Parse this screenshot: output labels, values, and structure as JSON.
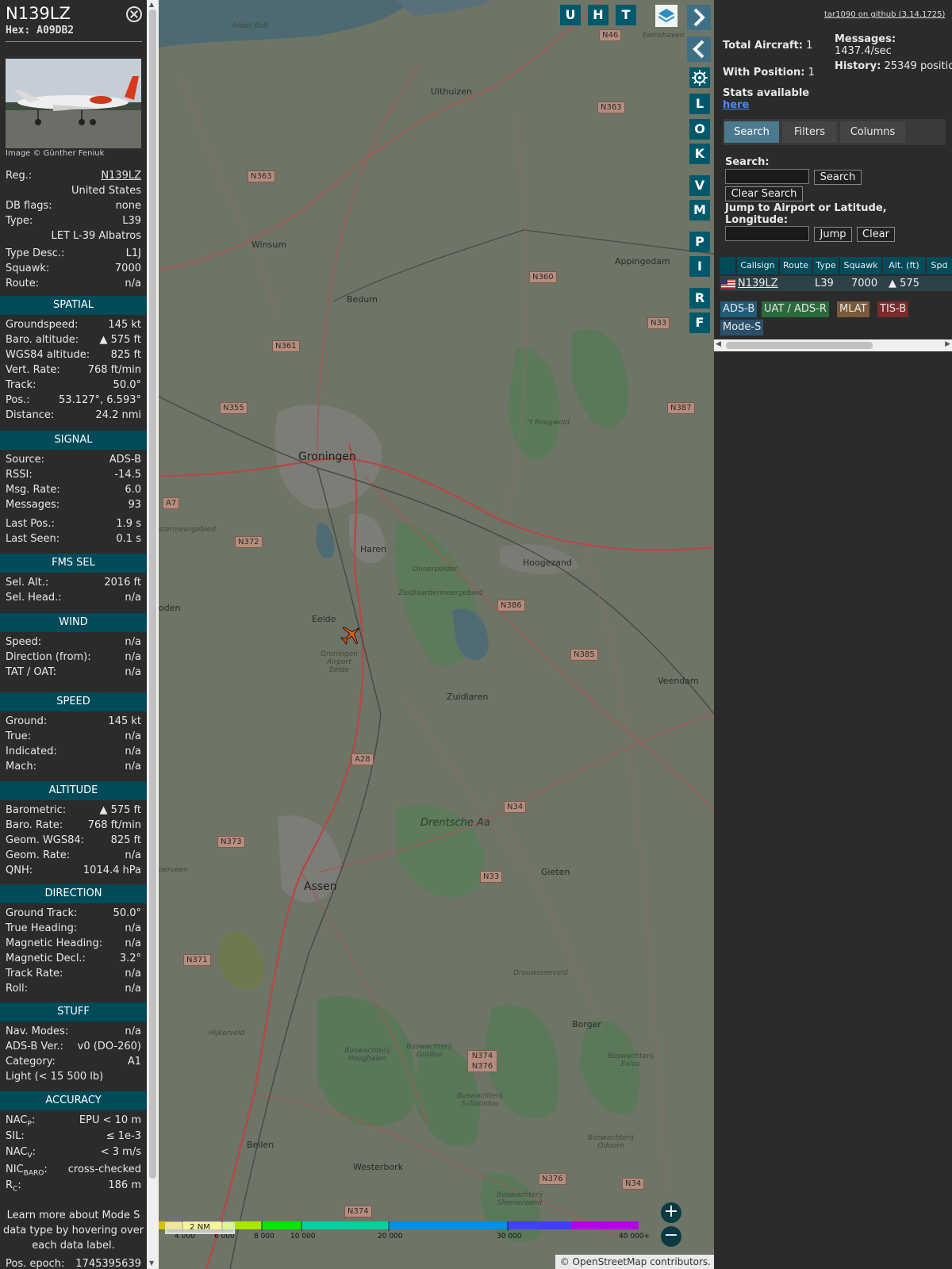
{
  "header": {
    "registration": "N139LZ",
    "hex_label": "Hex:",
    "hex": "A09DB2"
  },
  "photo": {
    "credit": "Image © Günther Feniuk"
  },
  "aircraft": [
    {
      "key": "Reg.:",
      "value": "N139LZ"
    },
    {
      "key": "",
      "value": "United States"
    },
    {
      "key": "DB flags:",
      "value": "none"
    },
    {
      "key": "Type:",
      "value": "L39"
    },
    {
      "key": "",
      "value": "LET L-39 Albatros"
    },
    {
      "key": "Type Desc.:",
      "value": "L1J"
    },
    {
      "key": "Squawk:",
      "value": "7000"
    },
    {
      "key": "Route:",
      "value": "n/a"
    }
  ],
  "sections": {
    "spatial": {
      "title": "SPATIAL",
      "rows": [
        {
          "key": "Groundspeed:",
          "value": "145 kt"
        },
        {
          "key": "Baro. altitude:",
          "value": "▲ 575 ft"
        },
        {
          "key": "WGS84 altitude:",
          "value": "825 ft"
        },
        {
          "key": "Vert. Rate:",
          "value": "768 ft/min"
        },
        {
          "key": "Track:",
          "value": "50.0°"
        },
        {
          "key": "Pos.:",
          "value": "53.127°, 6.593°"
        },
        {
          "key": "Distance:",
          "value": "24.2 nmi"
        }
      ]
    },
    "signal": {
      "title": "SIGNAL",
      "rows": [
        {
          "key": "Source:",
          "value": "ADS-B"
        },
        {
          "key": "RSSI:",
          "value": "-14.5"
        },
        {
          "key": "Msg. Rate:",
          "value": "6.0"
        },
        {
          "key": "Messages:",
          "value": "93"
        },
        {
          "key": "Last Pos.:",
          "value": "1.9 s"
        },
        {
          "key": "Last Seen:",
          "value": "0.1 s"
        }
      ]
    },
    "fms": {
      "title": "FMS SEL",
      "rows": [
        {
          "key": "Sel. Alt.:",
          "value": "2016 ft"
        },
        {
          "key": "Sel. Head.:",
          "value": "n/a"
        }
      ]
    },
    "wind": {
      "title": "WIND",
      "rows": [
        {
          "key": "Speed:",
          "value": "n/a"
        },
        {
          "key": "Direction (from):",
          "value": "n/a"
        },
        {
          "key": "TAT / OAT:",
          "value": "n/a"
        }
      ]
    },
    "speed": {
      "title": "SPEED",
      "rows": [
        {
          "key": "Ground:",
          "value": "145 kt"
        },
        {
          "key": "True:",
          "value": "n/a"
        },
        {
          "key": "Indicated:",
          "value": "n/a"
        },
        {
          "key": "Mach:",
          "value": "n/a"
        }
      ]
    },
    "altitude": {
      "title": "ALTITUDE",
      "rows": [
        {
          "key": "Barometric:",
          "value": "▲ 575 ft"
        },
        {
          "key": "Baro. Rate:",
          "value": "768 ft/min"
        },
        {
          "key": "Geom. WGS84:",
          "value": "825 ft"
        },
        {
          "key": "Geom. Rate:",
          "value": "n/a"
        },
        {
          "key": "QNH:",
          "value": "1014.4 hPa"
        }
      ]
    },
    "direction": {
      "title": "DIRECTION",
      "rows": [
        {
          "key": "Ground Track:",
          "value": "50.0°"
        },
        {
          "key": "True Heading:",
          "value": "n/a"
        },
        {
          "key": "Magnetic Heading:",
          "value": "n/a"
        },
        {
          "key": "Magnetic Decl.:",
          "value": "3.2°"
        },
        {
          "key": "Track Rate:",
          "value": "n/a"
        },
        {
          "key": "Roll:",
          "value": "n/a"
        }
      ]
    },
    "stuff": {
      "title": "STUFF",
      "rows": [
        {
          "key": "Nav. Modes:",
          "value": "n/a"
        },
        {
          "key": "ADS-B Ver.:",
          "value": "v0 (DO-260)"
        },
        {
          "key": "Category:",
          "value": "A1"
        },
        {
          "key": "Light (< 15 500 lb)",
          "value": ""
        }
      ]
    },
    "accuracy": {
      "title": "ACCURACY",
      "rows": [
        {
          "key": "NAC",
          "sub": "P",
          "value": "EPU < 10 m"
        },
        {
          "key": "SIL:",
          "sub": "",
          "value": "≤ 1e-3"
        },
        {
          "key": "NAC",
          "sub": "V",
          "value": "< 3 m/s"
        },
        {
          "key": "NIC",
          "sub": "BARO",
          "value": "cross-checked"
        },
        {
          "key": "R",
          "sub": "C",
          "value": "186 m"
        }
      ]
    }
  },
  "learn_more": "Learn more about Mode S data type by hovering over each data label.",
  "pos_epoch": {
    "key": "Pos. epoch:",
    "value": "1745395639"
  },
  "map": {
    "top_buttons": [
      "U",
      "H",
      "T"
    ],
    "side_buttons": [
      "L",
      "O",
      "K",
      "V",
      "M",
      "P",
      "I",
      "R",
      "F"
    ],
    "places": [
      {
        "name": "Uithuizen"
      },
      {
        "name": "Winsum"
      },
      {
        "name": "Bedum"
      },
      {
        "name": "Groningen"
      },
      {
        "name": "Haren"
      },
      {
        "name": "Hoogezand"
      },
      {
        "name": "Eelde"
      },
      {
        "name": "Zuidlaren"
      },
      {
        "name": "Veendam"
      },
      {
        "name": "Gieten"
      },
      {
        "name": "Assen"
      },
      {
        "name": "Borger"
      },
      {
        "name": "Beilen"
      },
      {
        "name": "Westerbork"
      },
      {
        "name": "Appingedam"
      },
      {
        "name": "Andel Bult"
      },
      {
        "name": "Eemshaven"
      },
      {
        "name": "oden"
      }
    ],
    "roads": [
      "N46",
      "N363",
      "N363",
      "N361",
      "N360",
      "N355",
      "A7",
      "N372",
      "N386",
      "N385",
      "N387",
      "N33",
      "A28",
      "N34",
      "N373",
      "N33",
      "N371",
      "N374 N376",
      "N376",
      "N374",
      "N34"
    ],
    "nature_labels": [
      "Drentsche Aa",
      "Zuidlaardermeergebied",
      "Onnerpolder",
      "Drouwenerveld",
      "Hijkerveld",
      "Boswachterij Hooghalen",
      "Boswachterij Grolloo",
      "Boswachterij Schoonloo",
      "Boswachterij Exloo",
      "Boswachterij Odoorn",
      "Boswachterij Sleenerzand",
      "Groningen Airport Eelde",
      "'t Roegwold",
      "stermeergebied",
      "oerveen"
    ],
    "altitude_scale": {
      "ticks": [
        "4 000",
        "6 000",
        "8 000",
        "10 000",
        "20 000",
        "30 000",
        "40 000+"
      ],
      "colors": [
        "#d6c010",
        "#e6e600",
        "#a8e600",
        "#00e600",
        "#00cfa0",
        "#0090e6",
        "#4040ff",
        "#b400e6"
      ]
    },
    "scale_label": "2 NM",
    "attribution": "© OpenStreetMap contributors.",
    "zoom_in": "+",
    "zoom_out": "−"
  },
  "right": {
    "github": "tar1090 on github (3.14.1725)",
    "total_label": "Total Aircraft:",
    "total": "1",
    "withpos_label": "With Position:",
    "withpos": "1",
    "messages_label": "Messages:",
    "messages": "1437.4/sec",
    "history_label": "History:",
    "history": "25349 positions",
    "stats_label": "Stats available",
    "stats_link": "here",
    "tabs": [
      "Search",
      "Filters",
      "Columns"
    ],
    "search_label": "Search:",
    "search_button": "Search",
    "clear_search": "Clear Search",
    "jump_label": "Jump to Airport or Latitude, Longitude:",
    "jump_button": "Jump",
    "clear_button": "Clear",
    "table": {
      "columns": [
        "",
        "Callsign",
        "Route",
        "Type",
        "Squawk",
        "Alt. (ft)",
        "Spd"
      ],
      "rows": [
        {
          "callsign": "N139LZ",
          "route": "",
          "type": "L39",
          "squawk": "7000",
          "alt": "▲ 575"
        }
      ]
    },
    "sources": [
      {
        "label": "ADS-B",
        "color": "#1f5c78"
      },
      {
        "label": "UAT / ADS-R",
        "color": "#2b6a3a"
      },
      {
        "label": "MLAT",
        "color": "#7a5a3a"
      },
      {
        "label": "TIS-B",
        "color": "#7a2a2a"
      },
      {
        "label": "Mode-S",
        "color": "#2d4f6b"
      }
    ]
  }
}
